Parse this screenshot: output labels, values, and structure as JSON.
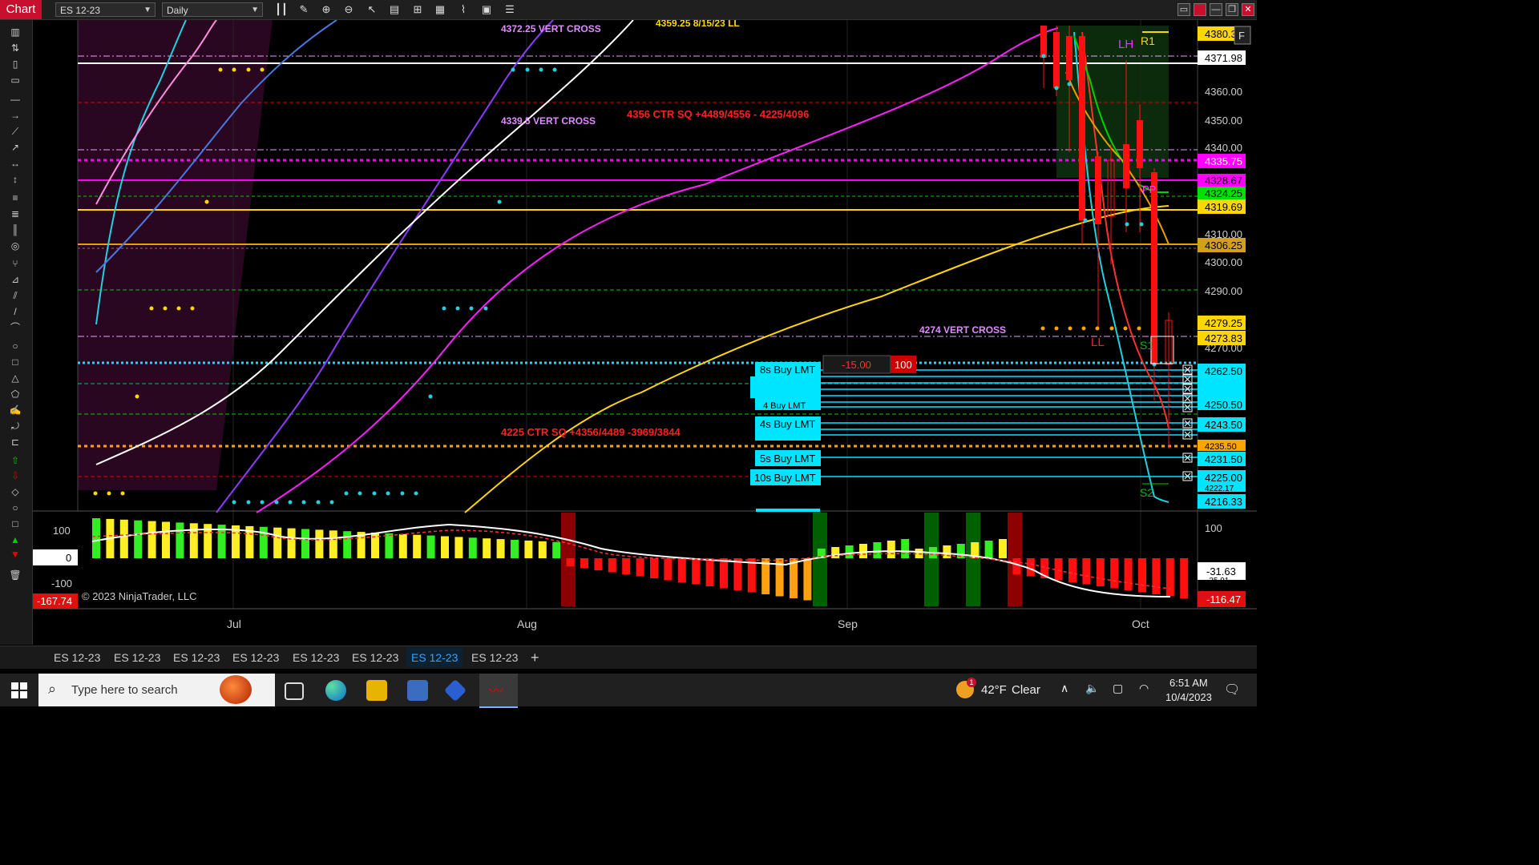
{
  "app": {
    "label": "Chart"
  },
  "toolbar": {
    "instrument": "ES 12-23",
    "interval": "Daily"
  },
  "window_buttons": [
    "▭",
    "■",
    "—",
    "❐",
    "✕"
  ],
  "chart": {
    "annotations": {
      "vc1": "4372.25 VERT CROSS",
      "partial_top": "4359.25 8/15/23 LL",
      "vc2": "4339.5 VERT CROSS",
      "ctr_sq1": "4356 CTR SQ +4489/4556 - 4225/4096",
      "vc3": "4274 VERT CROSS",
      "ctr_sq2": "4225 CTR SQ +4356/4489 -3969/3844",
      "lh": "LH",
      "r1": "R1",
      "ll": "LL",
      "s1": "S1",
      "s2": "S2",
      "pp": "PP",
      "f_badge": "F"
    },
    "price_ticks": [
      "4360.00",
      "4350.00",
      "4340.00",
      "4310.00",
      "4300.00",
      "4290.00",
      "4270.00"
    ],
    "price_flags": [
      {
        "label": "4380.3",
        "color": "#ffd700"
      },
      {
        "label": "4371.98",
        "color": "#ffffff"
      },
      {
        "label": "4335.75",
        "color": "#ff00ff"
      },
      {
        "label": "4328.67",
        "color": "#ff00ff"
      },
      {
        "label": "4324.25",
        "color": "#00e000"
      },
      {
        "label": "4319.69",
        "color": "#ffd700"
      },
      {
        "label": "4306.25",
        "color": "#d4a017"
      },
      {
        "label": "4279.25",
        "color": "#ffd700"
      },
      {
        "label": "4273.83",
        "color": "#ffd700"
      },
      {
        "label": "4262.50",
        "color": "#00e5ff"
      },
      {
        "label": "4250.50",
        "color": "#00e5ff"
      },
      {
        "label": "4243.50",
        "color": "#00e5ff"
      },
      {
        "label": "4235.50",
        "color": "#ffa500"
      },
      {
        "label": "4231.50",
        "color": "#00e5ff"
      },
      {
        "label": "4225.00",
        "color": "#00e5ff"
      },
      {
        "label": "4222.17",
        "color": "#00e5ff"
      },
      {
        "label": "4216.33",
        "color": "#00e5ff"
      }
    ],
    "orders": [
      {
        "label": "8s Buy LMT"
      },
      {
        "label": "4 Buy LMT"
      },
      {
        "label": "4s Buy LMT"
      },
      {
        "label": "5s Buy LMT"
      },
      {
        "label": "10s Buy LMT"
      }
    ],
    "order_pnl": "-15.00",
    "order_qty": "100",
    "osc_ticks": [
      "100",
      "0",
      "-100"
    ],
    "osc_left_flag": "-167.74",
    "osc_right_flags": [
      "100",
      "-31.63",
      "-35.91",
      "-116.47"
    ],
    "copyright": "© 2023 NinjaTrader, LLC",
    "x_ticks": [
      "Jul",
      "Aug",
      "Sep",
      "Oct"
    ]
  },
  "tabs": [
    "ES 12-23",
    "ES 12-23",
    "ES 12-23",
    "ES 12-23",
    "ES 12-23",
    "ES 12-23",
    "ES 12-23",
    "ES 12-23"
  ],
  "active_tab": 5,
  "add_tab": "+",
  "taskbar": {
    "search_placeholder": "Type here to search",
    "weather_temp": "42°F",
    "weather_cond": "Clear",
    "weather_badge": "1",
    "time": "6:51 AM",
    "date": "10/4/2023"
  }
}
